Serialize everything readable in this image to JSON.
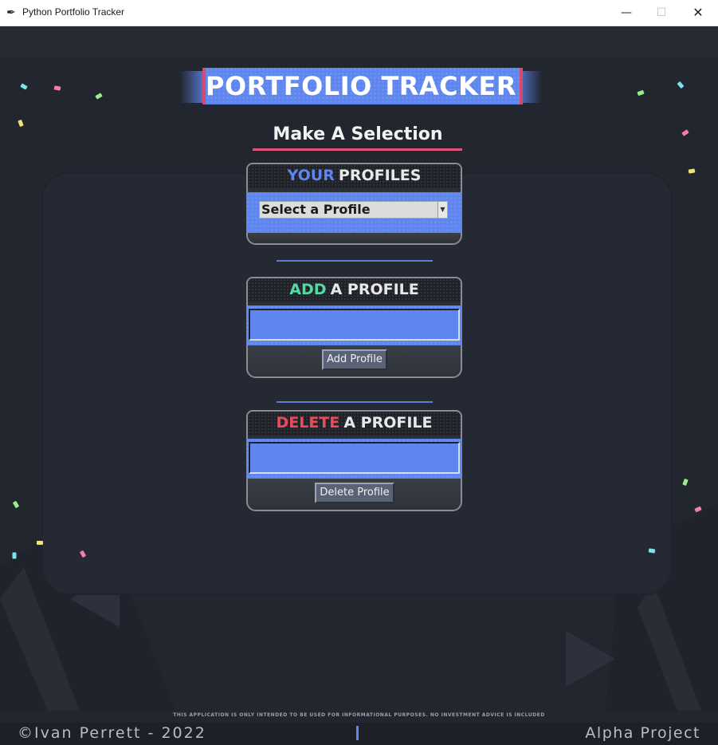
{
  "window": {
    "title": "Python Portfolio Tracker",
    "icon": "feather-icon",
    "controls": {
      "minimize": "—",
      "maximize": "☐",
      "close": "✕"
    }
  },
  "banner": {
    "title": "PORTFOLIO TRACKER"
  },
  "heading": "Make A Selection",
  "sections": {
    "your_profiles": {
      "word1": "YOUR",
      "word2": "PROFILES",
      "word1_color": "#5e86ee",
      "select_value": "Select a Profile"
    },
    "add_profile": {
      "word1": "ADD",
      "word2": "A PROFILE",
      "word1_color": "#55d9a0",
      "input_value": "",
      "button_label": "Add Profile"
    },
    "delete_profile": {
      "word1": "DELETE",
      "word2": "A PROFILE",
      "word1_color": "#ea4a5a",
      "input_value": "",
      "button_label": "Delete Profile"
    }
  },
  "footer": {
    "disclaimer": "THIS APPLICATION IS ONLY INTENDED TO BE USED FOR INFORMATIONAL PURPOSES. NO INVESTMENT ADVICE IS INCLUDED",
    "left": "©Ivan Perrett - 2022",
    "right": "Alpha Project"
  },
  "colors": {
    "accent_blue": "#5e86ee",
    "accent_pink": "#e05477",
    "background": "#22262f"
  }
}
